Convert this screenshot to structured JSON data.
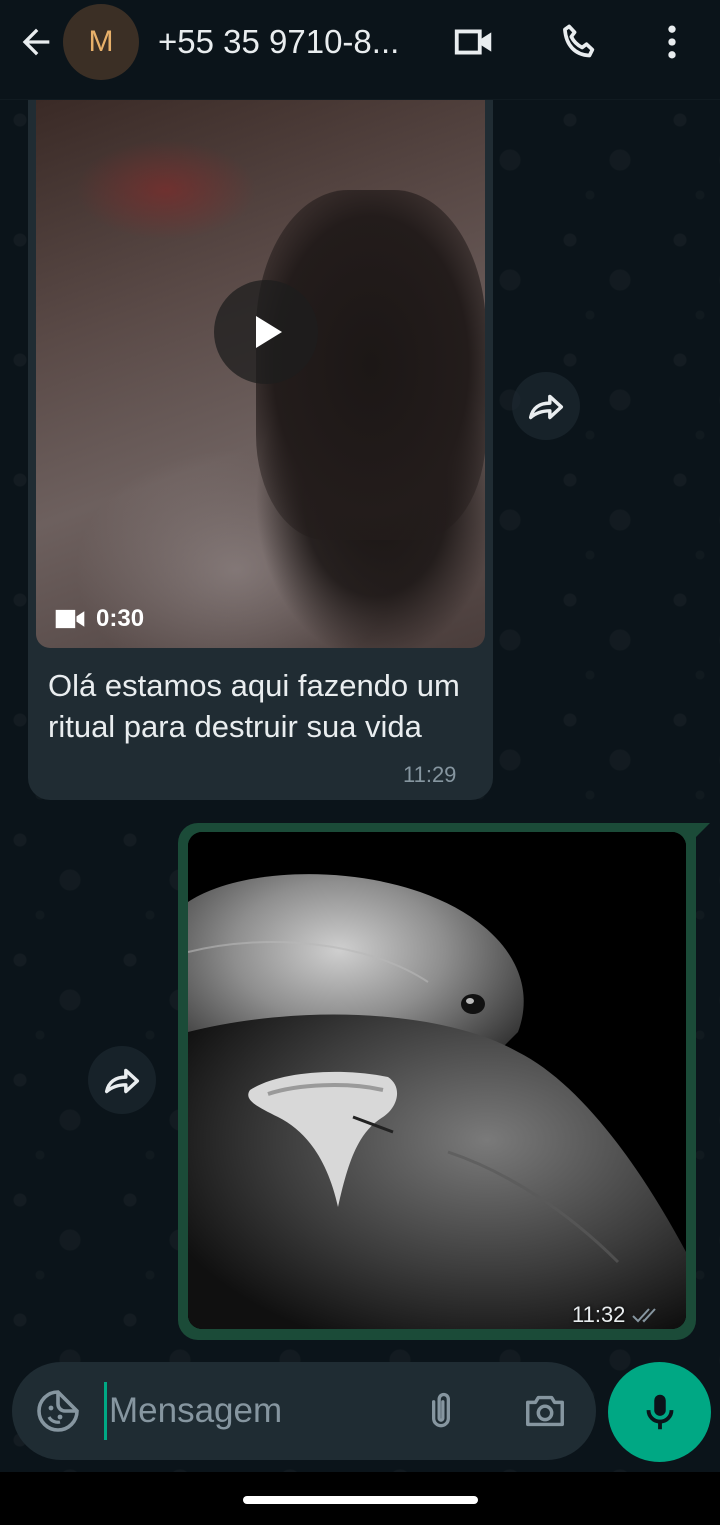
{
  "header": {
    "avatar_initial": "M",
    "contact_name": "+55 35 9710-8...",
    "icons": [
      "back-arrow-icon",
      "video-camera-icon",
      "phone-icon",
      "more-vertical-icon"
    ]
  },
  "messages": [
    {
      "direction": "incoming",
      "type": "video",
      "video_duration": "0:30",
      "caption": "Olá estamos aqui fazendo um ritual para destruir sua vida",
      "time": "11:29"
    },
    {
      "direction": "outgoing",
      "type": "image",
      "image_subject": "pigeon",
      "time": "11:32"
    }
  ],
  "composer": {
    "placeholder": "Mensagem"
  },
  "colors": {
    "background": "#0b141a",
    "incoming_bubble": "#202c33",
    "outgoing_bubble": "#1b4b38",
    "accent": "#00a884",
    "secondary_text": "#8696a0"
  }
}
